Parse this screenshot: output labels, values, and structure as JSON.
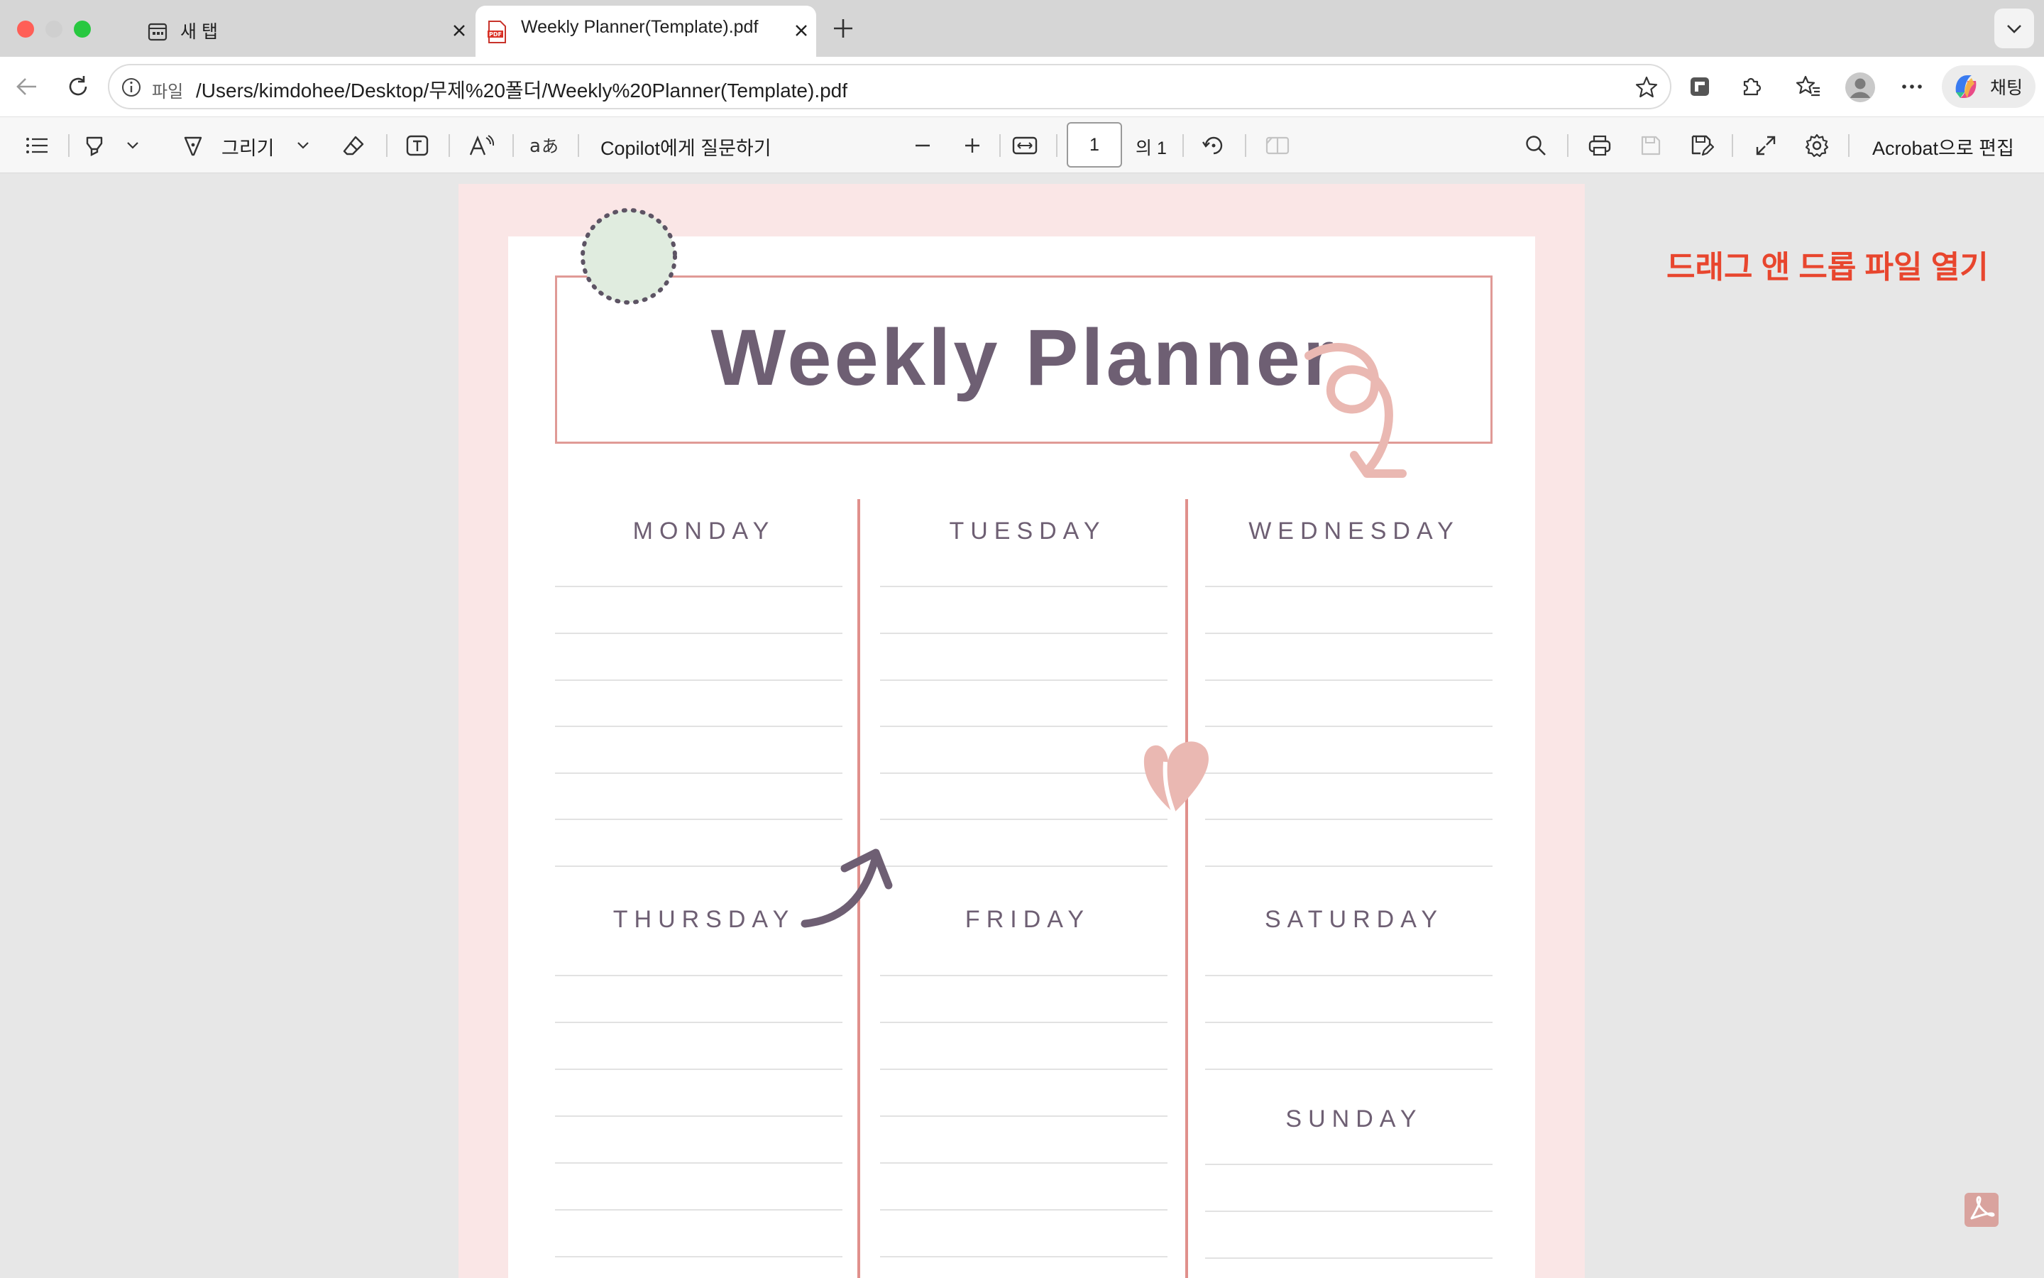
{
  "browser": {
    "tabs": [
      {
        "label": "새 탭",
        "icon": "new-tab-icon",
        "active": false
      },
      {
        "label": "Weekly Planner(Template).pdf",
        "icon": "pdf-file-icon",
        "active": true
      }
    ],
    "address": {
      "scheme_label": "파일",
      "url": "/Users/kimdohee/Desktop/무제%20폴더/Weekly%20Planner(Template).pdf"
    },
    "chat_label": "채팅"
  },
  "pdf_toolbar": {
    "draw_label": "그리기",
    "copilot_label": "Copilot에게 질문하기",
    "page_number": "1",
    "page_total": "의 1",
    "acrobat_label": "Acrobat으로 편집"
  },
  "document": {
    "title": "Weekly Planner",
    "days": {
      "monday": "MONDAY",
      "tuesday": "TUESDAY",
      "wednesday": "WEDNESDAY",
      "thursday": "THURSDAY",
      "friday": "FRIDAY",
      "saturday": "SATURDAY",
      "sunday": "SUNDAY"
    }
  },
  "viewer": {
    "drop_hint": "드래그 앤 드롭 파일 열기"
  },
  "colors": {
    "accent_title": "#6e5f73",
    "border_pink": "#e09a96",
    "page_bg": "#fae6e6",
    "drop_hint": "#e8462e"
  }
}
